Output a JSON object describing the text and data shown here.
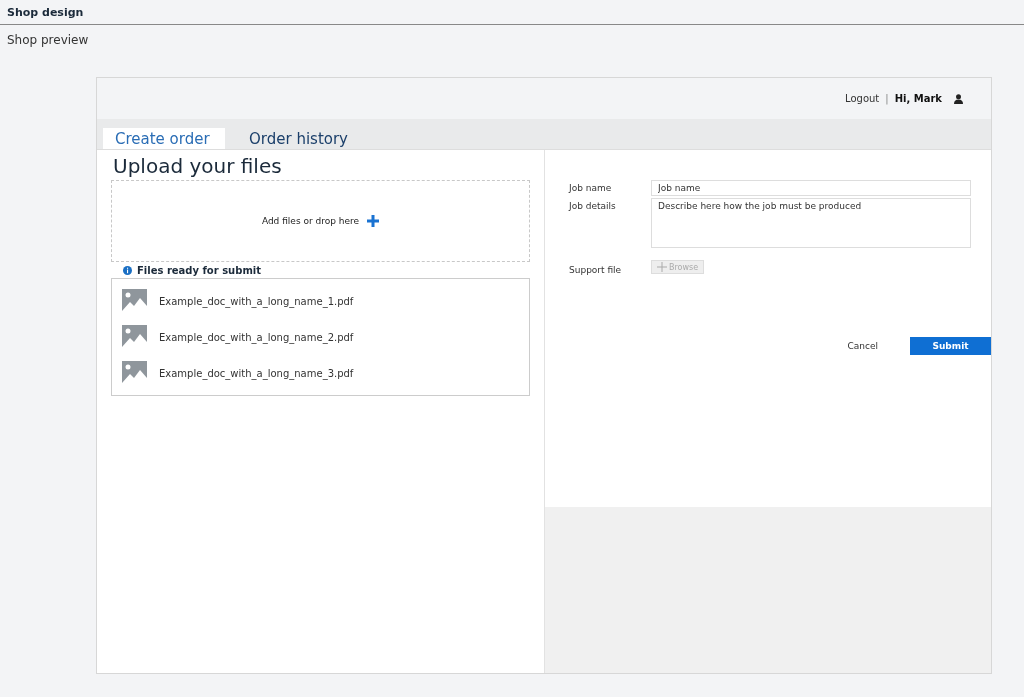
{
  "header": {
    "title": "Shop design",
    "subtitle": "Shop preview"
  },
  "user_bar": {
    "logout": "Logout",
    "separator": "|",
    "greeting": "Hi, Mark"
  },
  "tabs": [
    {
      "label": "Create order",
      "selected": true
    },
    {
      "label": "Order history",
      "selected": false
    }
  ],
  "upload": {
    "heading": "Upload your files",
    "dropzone": "Add files or drop here",
    "ready_label": "Files ready for submit",
    "files": [
      {
        "name": "Example_doc_with_a_long_name_1.pdf"
      },
      {
        "name": "Example_doc_with_a_long_name_2.pdf"
      },
      {
        "name": "Example_doc_with_a_long_name_3.pdf"
      }
    ]
  },
  "form": {
    "job_name": {
      "label": "Job name",
      "placeholder": "Job name"
    },
    "job_details": {
      "label": "Job details",
      "placeholder": "Describe here how the job must be produced"
    },
    "support_file": {
      "label": "Support file",
      "button": "Browse",
      "disabled": true
    },
    "cancel": "Cancel",
    "submit": "Submit"
  }
}
